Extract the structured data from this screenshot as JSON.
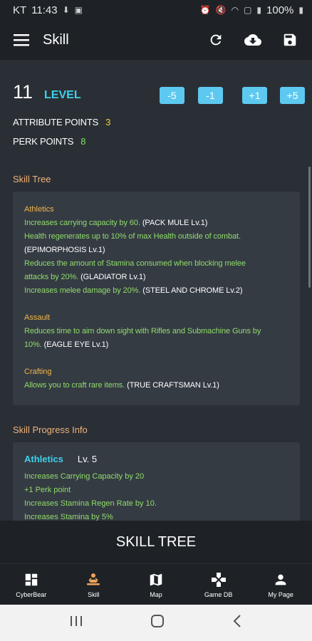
{
  "status_bar": {
    "carrier": "KT",
    "time": "11:43",
    "battery": "100%"
  },
  "app_bar": {
    "title": "Skill"
  },
  "level": {
    "value": "11",
    "label": "LEVEL",
    "buttons": [
      "-5",
      "-1",
      "+1",
      "+5"
    ]
  },
  "points": {
    "attribute_label": "ATTRIBUTE POINTS",
    "attribute_value": "3",
    "perk_label": "PERK POINTS",
    "perk_value": "8"
  },
  "skill_tree": {
    "title": "Skill Tree",
    "categories": [
      {
        "name": "Athletics",
        "lines": [
          "Increases carrying capacity by 60. (PACK MULE Lv.1)",
          "Health regenerates up to 10% of max Health outside of combat.",
          "(EPIMORPHOSIS Lv.1)",
          "Reduces the amount of Stamina consumed when blocking melee",
          "attacks by 20%. (GLADIATOR Lv.1)",
          "Increases melee damage by 20%. (STEEL AND CHROME Lv.2)"
        ]
      },
      {
        "name": "Assault",
        "lines": [
          "Reduces time to aim down sight with Rifles and Submachine Guns by",
          "10%. (EAGLE EYE Lv.1)"
        ]
      },
      {
        "name": "Crafting",
        "lines": [
          "Allows you to craft rare items. (TRUE CRAFTSMAN Lv.1)"
        ]
      }
    ]
  },
  "progress": {
    "title": "Skill Progress Info",
    "skill_name": "Athletics",
    "skill_level": "Lv. 5",
    "lines": [
      "Increases Carrying Capacity by 20",
      "+1 Perk point",
      "Increases Stamina Regen Rate by 10.",
      "Increases Stamina by 5%"
    ]
  },
  "bottom_banner": "SKILL TREE",
  "nav": [
    {
      "label": "CyberBear",
      "icon": "dashboard-icon"
    },
    {
      "label": "Skill",
      "icon": "skill-icon",
      "active": true
    },
    {
      "label": "Map",
      "icon": "map-icon"
    },
    {
      "label": "Game DB",
      "icon": "gamepad-icon"
    },
    {
      "label": "My Page",
      "icon": "person-icon"
    }
  ],
  "colors": {
    "accent_cyan": "#3ed1ea",
    "section_orange": "#f0b27a",
    "text_green": "#8fdc6a",
    "button_blue": "#5ec9f0",
    "nav_active": "#f0a45a"
  }
}
